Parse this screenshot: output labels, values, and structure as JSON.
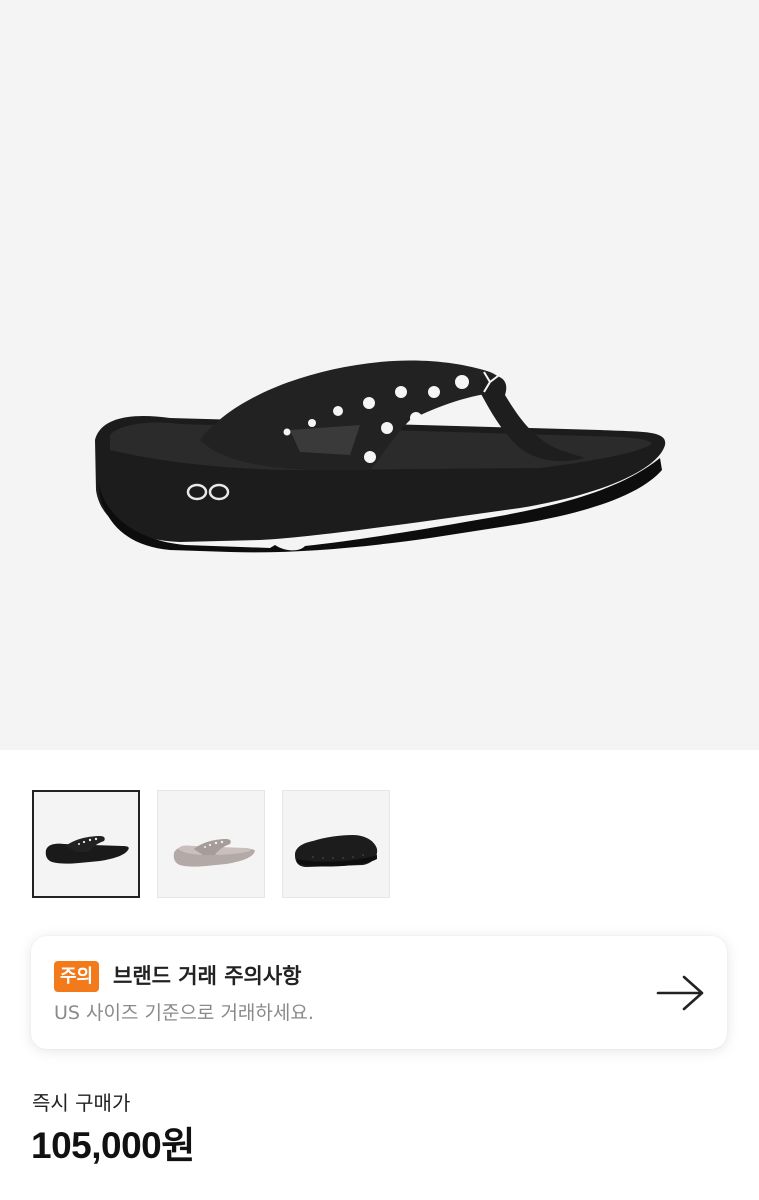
{
  "product": {
    "main_image": "black-flip-flop-sandal",
    "logo_text": "OO"
  },
  "thumbnails": [
    {
      "image": "black-flip-flop-sandal",
      "selected": true
    },
    {
      "image": "taupe-flip-flop-sandal",
      "selected": false
    },
    {
      "image": "black-slide-sandal",
      "selected": false
    }
  ],
  "notice": {
    "badge": "주의",
    "title": "브랜드 거래 주의사항",
    "subtitle": "US 사이즈 기준으로 거래하세요.",
    "icon": "arrow-right-icon"
  },
  "price": {
    "label": "즉시 구매가",
    "value": "105,000원"
  },
  "colors": {
    "accent": "#f27a1a",
    "hero_bg": "#f4f4f4"
  }
}
